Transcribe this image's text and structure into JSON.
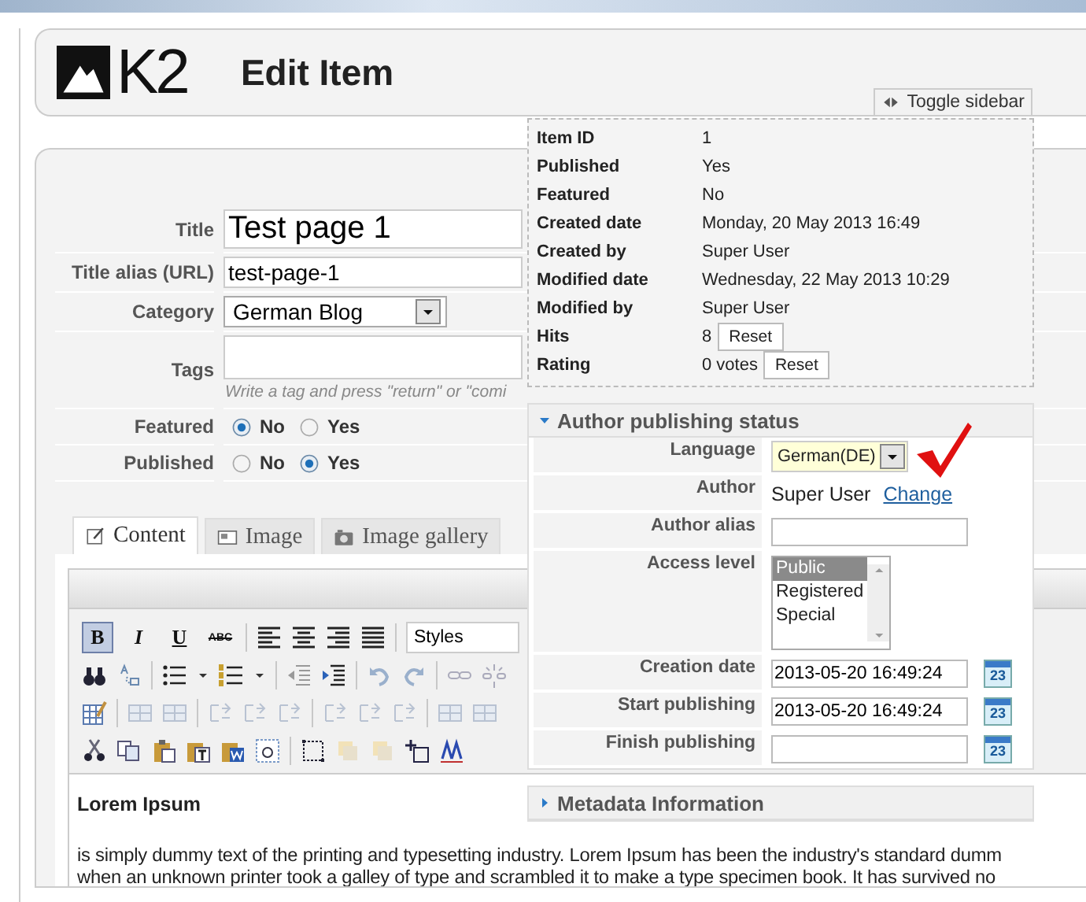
{
  "header": {
    "logo_text": "K2",
    "title": "Edit Item"
  },
  "form": {
    "fields": [
      {
        "kind": "text",
        "label": "Title",
        "value": "Test page 1"
      },
      {
        "kind": "alias",
        "label": "Title alias (URL)",
        "value": "test-page-1"
      },
      {
        "kind": "select",
        "label": "Category",
        "value": "German Blog"
      },
      {
        "kind": "tags",
        "label": "Tags",
        "hint": "Write a tag and press \"return\" or \"comi"
      },
      {
        "kind": "radio",
        "label": "Featured",
        "options": [
          {
            "label": "No",
            "selected": true
          },
          {
            "label": "Yes",
            "selected": false
          }
        ]
      },
      {
        "kind": "radio",
        "label": "Published",
        "options": [
          {
            "label": "No",
            "selected": false
          },
          {
            "label": "Yes",
            "selected": true
          }
        ]
      }
    ]
  },
  "tabs": [
    {
      "label": "Content",
      "selected": true
    },
    {
      "label": "Image",
      "selected": false
    },
    {
      "label": "Image gallery",
      "selected": false
    }
  ],
  "editor": {
    "toolbar": {
      "format_buttons": [
        {
          "label": "B",
          "selected": true
        },
        {
          "label": "I",
          "selected": false
        },
        {
          "label": "U",
          "selected": false
        },
        {
          "label": "ABC",
          "selected": false
        }
      ],
      "styles": "Styles"
    },
    "heading": "Lorem Ipsum",
    "body_lines": [
      "is simply dummy text of the printing and typesetting industry. Lorem Ipsum has been the industry's standard dumm",
      "when an unknown printer took a galley of type and scrambled it to make a type specimen book. It has survived no"
    ]
  },
  "sidebar": {
    "toggle": "Toggle sidebar",
    "info": [
      {
        "label": "Item ID",
        "value": "1"
      },
      {
        "label": "Published",
        "value": "Yes"
      },
      {
        "label": "Featured",
        "value": "No"
      },
      {
        "label": "Created date",
        "value": "Monday, 20 May 2013 16:49"
      },
      {
        "label": "Created by",
        "value": "Super User"
      },
      {
        "label": "Modified date",
        "value": "Wednesday, 22 May 2013 10:29"
      },
      {
        "label": "Modified by",
        "value": "Super User"
      },
      {
        "label": "Hits",
        "value": "8",
        "button": "Reset"
      },
      {
        "label": "Rating",
        "value": "0 votes",
        "button": "Reset"
      }
    ],
    "panels": [
      {
        "title": "Author publishing status",
        "expanded": true,
        "rows": [
          {
            "kind": "select",
            "label": "Language",
            "value": "German(DE)"
          },
          {
            "kind": "author",
            "label": "Author",
            "value": "Super User",
            "link": "Change"
          },
          {
            "kind": "text",
            "label": "Author alias"
          },
          {
            "kind": "list",
            "label": "Access level",
            "options": [
              {
                "label": "Public",
                "selected": true
              },
              {
                "label": "Registered",
                "selected": false
              },
              {
                "label": "Special",
                "selected": false
              }
            ]
          },
          {
            "kind": "date",
            "label": "Creation date",
            "value": "2013-05-20 16:49:24",
            "calendar": "23"
          },
          {
            "kind": "date",
            "label": "Start publishing",
            "value": "2013-05-20 16:49:24",
            "calendar": "23"
          },
          {
            "kind": "date",
            "label": "Finish publishing",
            "calendar": "23"
          }
        ]
      },
      {
        "title": "Metadata Information",
        "expanded": false
      }
    ]
  }
}
